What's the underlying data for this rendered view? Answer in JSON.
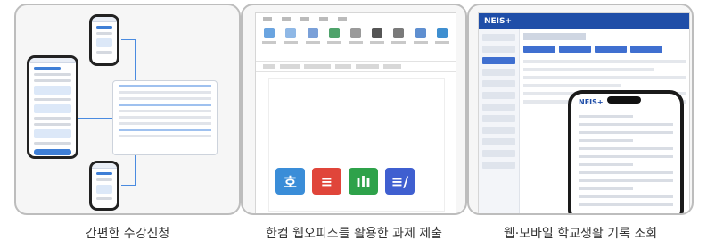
{
  "panels": [
    {
      "caption": "간편한 수강신청"
    },
    {
      "caption": "한컴 웹오피스를 활용한 과제 제출",
      "app_tiles": [
        {
          "glyph": "호",
          "icon": "hancom-hwp-icon",
          "color": "#3a8dd8"
        },
        {
          "glyph": "≡",
          "icon": "hancom-show-icon",
          "color": "#e0453a"
        },
        {
          "glyph": "ılı",
          "icon": "hancom-cell-icon",
          "color": "#2ea24a"
        },
        {
          "glyph": "≡/",
          "icon": "hancom-docs-icon",
          "color": "#3f5fd0"
        }
      ]
    },
    {
      "caption": "웹·모바일 학교생활 기록 조회",
      "logo": "NEIS+",
      "mobile_logo": "NEIS+"
    }
  ],
  "colors": {
    "card_border": "#bdbdbd",
    "neis_blue": "#1f4ea8",
    "accent_blue": "#4a8be0"
  }
}
